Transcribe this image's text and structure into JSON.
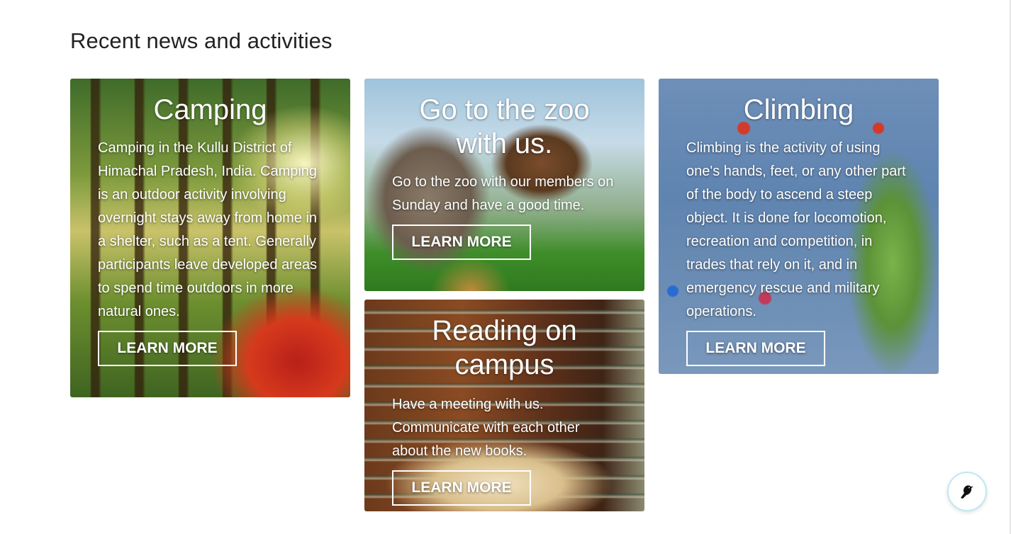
{
  "section": {
    "title": "Recent news and activities"
  },
  "cards": [
    {
      "id": "camping",
      "title": "Camping",
      "text": "Camping in the Kullu District of Himachal Pradesh, India. Camping is an outdoor activity involving overnight stays away from home in a shelter, such as a tent. Generally participants leave developed areas to spend time outdoors in more natural ones.",
      "button": "LEARN MORE"
    },
    {
      "id": "zoo",
      "title": "Go to the zoo with us.",
      "text": "Go to the zoo with our members on Sunday and have a good time.",
      "button": "LEARN MORE"
    },
    {
      "id": "reading",
      "title": "Reading on campus",
      "text": "Have a meeting with us. Communicate with each other about the new books.",
      "button": "LEARN MORE"
    },
    {
      "id": "climbing",
      "title": "Climbing",
      "text": "Climbing is the activity of using one's hands, feet, or any other part of the body to ascend a steep object. It is done for locomotion, recreation and competition, in trades that rely on it, and in emergency rescue and military operations.",
      "button": "LEARN MORE"
    }
  ],
  "chat_widget": {
    "icon": "bird-icon",
    "border_color": "#bfe9f2"
  }
}
